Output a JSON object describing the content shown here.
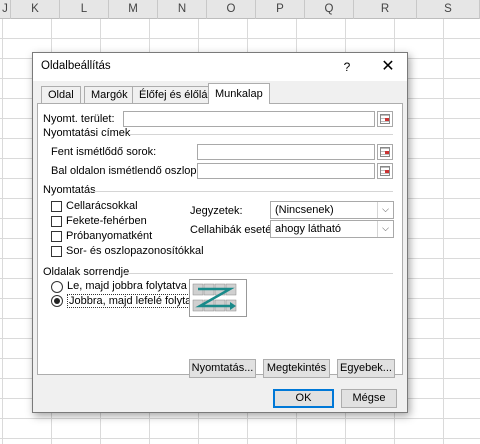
{
  "columns": [
    "J",
    "K",
    "L",
    "M",
    "N",
    "O",
    "P",
    "Q",
    "R",
    "S"
  ],
  "dialog": {
    "title": "Oldalbeállítás",
    "help": "?",
    "close": "✕",
    "tabs": [
      "Oldal",
      "Margók",
      "Élőfej és élőláb",
      "Munkalap"
    ],
    "active_tab": "Munkalap",
    "print_area_label": "Nyomt. terület:",
    "print_titles_section": "Nyomtatási címek",
    "rows_repeat_label": "Fent ismétlődő sorok:",
    "cols_repeat_label": "Bal oldalon ismétlendő oszlopok:",
    "print_section": "Nyomtatás",
    "checkboxes": [
      "Cellarácsokkal",
      "Fekete-fehérben",
      "Próbanyomatként",
      "Sor- és oszlopazonosítókkal"
    ],
    "comments_label": "Jegyzetek:",
    "comments_value": "(Nincsenek)",
    "errors_label": "Cellahibák esetén:",
    "errors_value": "ahogy látható",
    "order_section": "Oldalak sorrendje",
    "order_options": [
      "Le, majd jobbra folytatva",
      "Jobbra, majd lefelé folytatva"
    ],
    "order_selected": 1,
    "buttons": {
      "print": "Nyomtatás...",
      "preview": "Megtekintés",
      "options": "Egyebek...",
      "ok": "OK",
      "cancel": "Mégse"
    }
  }
}
